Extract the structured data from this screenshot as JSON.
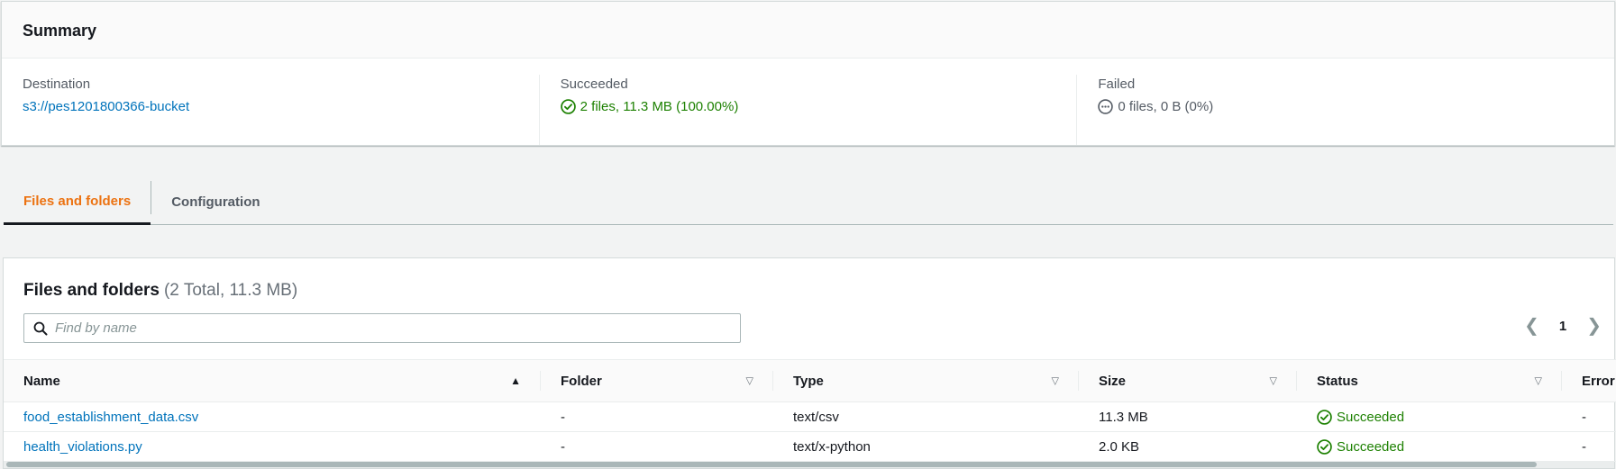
{
  "summary": {
    "title": "Summary",
    "destination": {
      "label": "Destination",
      "value": "s3://pes1201800366-bucket"
    },
    "succeeded": {
      "label": "Succeeded",
      "value": "2 files, 11.3 MB (100.00%)"
    },
    "failed": {
      "label": "Failed",
      "value": "0 files, 0 B (0%)"
    }
  },
  "tabs": [
    {
      "label": "Files and folders",
      "active": true
    },
    {
      "label": "Configuration",
      "active": false
    }
  ],
  "files": {
    "title": "Files and folders",
    "count": "(2 Total, 11.3 MB)",
    "search_placeholder": "Find by name",
    "page": "1",
    "columns": [
      "Name",
      "Folder",
      "Type",
      "Size",
      "Status",
      "Error"
    ],
    "rows": [
      {
        "name": "food_establishment_data.csv",
        "folder": "-",
        "type": "text/csv",
        "size": "11.3 MB",
        "status": "Succeeded",
        "error": "-"
      },
      {
        "name": "health_violations.py",
        "folder": "-",
        "type": "text/x-python",
        "size": "2.0 KB",
        "status": "Succeeded",
        "error": "-"
      }
    ]
  },
  "colors": {
    "link": "#0073bb",
    "success": "#1d8102",
    "active_tab": "#ec7211",
    "muted": "#545b64"
  },
  "icons": {
    "succeeded": "check-circle-icon",
    "failed": "ellipsis-circle-icon",
    "search": "search-icon",
    "prev": "chevron-left-icon",
    "next": "chevron-right-icon",
    "sort_asc": "sort-ascending-icon",
    "sort": "sort-icon"
  }
}
